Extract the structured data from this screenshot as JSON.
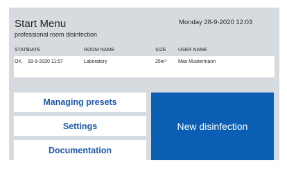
{
  "header": {
    "title": "Start Menu",
    "subtitle": "professional room disinfection",
    "datetime": "Monday 28-9-2020 12:03"
  },
  "table": {
    "columns": [
      "STATE",
      "DATE",
      "ROOM NAME",
      "SIZE",
      "USER NAME"
    ],
    "rows": [
      [
        "OK",
        "28-9-2020 11:57",
        "Laboratory",
        "25m³",
        "Max Mustermann"
      ]
    ]
  },
  "menu": {
    "presets_label": "Managing presets",
    "settings_label": "Settings",
    "documentation_label": "Documentation",
    "new_disinfection_label": "New disinfection"
  },
  "colors": {
    "background": "#d6dbe0",
    "accent": "#0a5eb4",
    "button_text": "#1e5aa8"
  }
}
